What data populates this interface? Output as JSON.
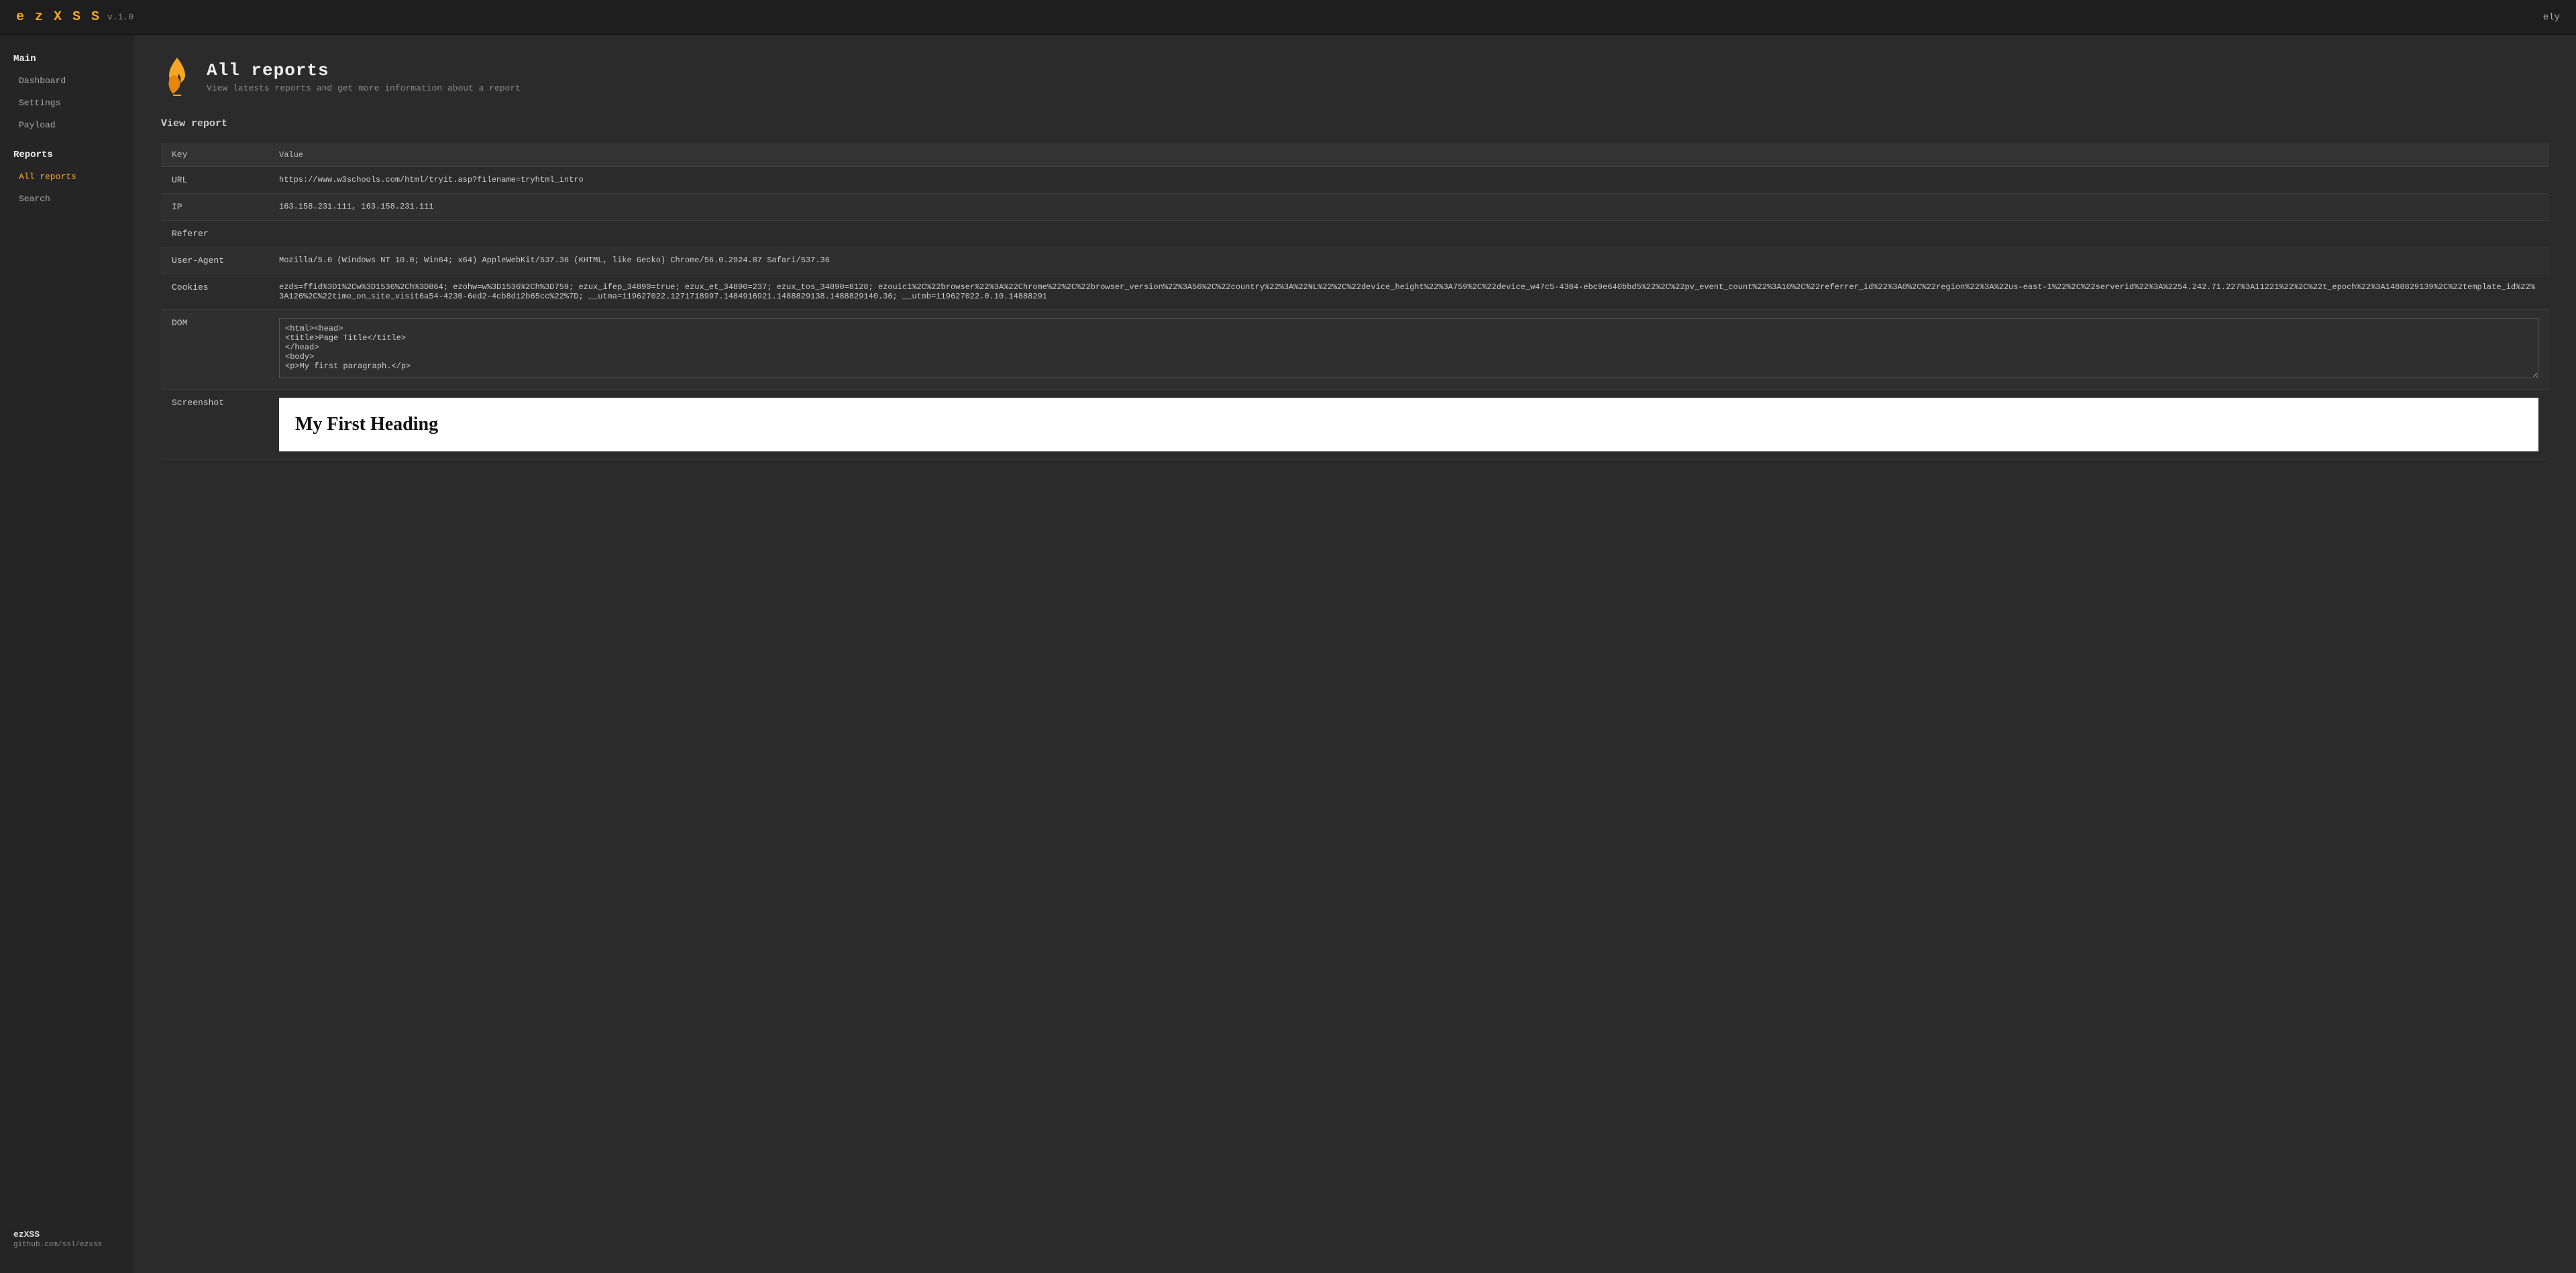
{
  "topbar": {
    "brand": "e z X S S",
    "version": "v.1.0",
    "user": "ely"
  },
  "sidebar": {
    "main_label": "Main",
    "items_main": [
      {
        "id": "dashboard",
        "label": "Dashboard"
      },
      {
        "id": "settings",
        "label": "Settings"
      },
      {
        "id": "payload",
        "label": "Payload"
      }
    ],
    "reports_label": "Reports",
    "items_reports": [
      {
        "id": "all-reports",
        "label": "All reports"
      },
      {
        "id": "search",
        "label": "Search"
      }
    ],
    "footer_app": "ezXSS",
    "footer_github": "github.com/ssl/ezxss"
  },
  "page": {
    "title": "All reports",
    "subtitle": "View latests reports and get more information about a report",
    "view_report_label": "View report"
  },
  "table": {
    "col_key": "Key",
    "col_value": "Value",
    "rows": [
      {
        "key": "URL",
        "value": "https://www.w3schools.com/html/tryit.asp?filename=tryhtml_intro"
      },
      {
        "key": "IP",
        "value": "163.158.231.111, 163.158.231.111"
      },
      {
        "key": "Referer",
        "value": ""
      },
      {
        "key": "User-Agent",
        "value": "Mozilla/5.0 (Windows NT 10.0; Win64; x64) AppleWebKit/537.36 (KHTML, like Gecko) Chrome/56.0.2924.87 Safari/537.36"
      },
      {
        "key": "Cookies",
        "value": "ezds=ffid%3D1%2Cw%3D1536%2Ch%3D864; ezohw=w%3D1536%2Ch%3D759; ezux_ifep_34890=true; ezux_et_34890=237; ezux_tos_34890=8128; ezouic1%2C%22browser%22%3A%22Chrome%22%2C%22browser_version%22%3A56%2C%22country%22%3A%22NL%22%2C%22device_height%22%3A759%2C%22device_w47c5-4304-ebc9e640bbd5%22%2C%22pv_event_count%22%3A10%2C%22referrer_id%22%3A0%2C%22region%22%3A%22us-east-1%22%2C%22serverid%22%3A%2254.242.71.227%3A11221%22%2C%22t_epoch%22%3A1488829139%2C%22template_id%22%3A126%2C%22time_on_site_visit6a54-4230-6ed2-4cb8d12b65cc%22%7D; __utma=119627022.1271718997.1484916921.1488829138.1488829140.36; __utmb=119627022.0.10.14888291"
      },
      {
        "key": "DOM",
        "value": "<html><head>\n<title>Page Title</title>\n</head>\n<body>\n<p>My first paragraph.</p>"
      },
      {
        "key": "Screenshot",
        "value": "My First Heading"
      }
    ]
  }
}
